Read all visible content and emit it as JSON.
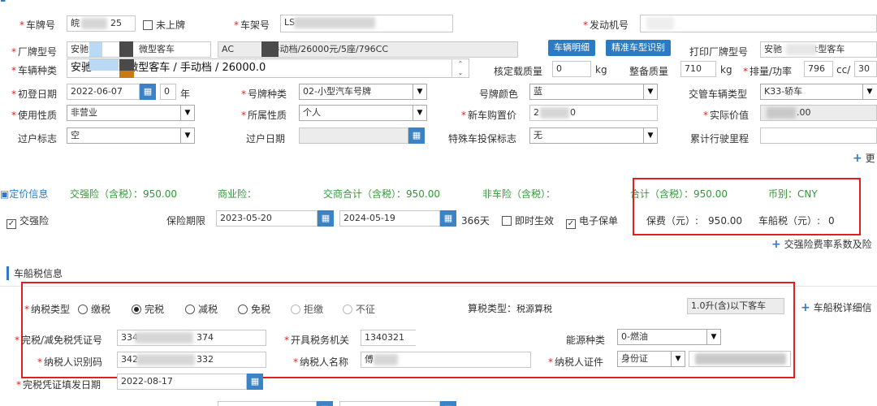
{
  "vehicle": {
    "plate_label": "车牌号",
    "plate_value": "皖",
    "plate_suffix": "25",
    "unplated_label": "未上牌",
    "vin_label": "车架号",
    "vin_value": "LS",
    "engine_label": "发动机号",
    "model_label": "厂牌型号",
    "model_value_a": "安驰",
    "model_value_b": "微型客车",
    "model_value_c": "AC",
    "model_value_d": "V手动档/26000元/5座/796CC",
    "detail_button": "车辆明细",
    "precise_button": "精准车型识别",
    "print_model_label": "打印厂牌型号",
    "print_model_value_a": "安驰",
    "print_model_value_b": "t型客车",
    "type_label": "车辆种类",
    "type_value_a": "安驰",
    "type_value_b": "E微型客车 / 手动档 / 26000.0",
    "load_label": "核定载质量",
    "load_value": "0",
    "load_unit": "kg",
    "curb_label": "整备质量",
    "curb_value": "710",
    "curb_unit": "kg",
    "power_label": "排量/功率",
    "power_value": "796",
    "power_unit": "cc/",
    "power_value2": "30",
    "reg_date_label": "初登日期",
    "reg_date_value": "2022-06-07",
    "years_value": "0",
    "years_unit": "年",
    "plate_type_label": "号牌种类",
    "plate_type_value": "02-小型汽车号牌",
    "plate_color_label": "号牌颜色",
    "plate_color_value": "蓝",
    "traffic_type_label": "交管车辆类型",
    "traffic_type_value": "K33-轿车",
    "usage_label": "使用性质",
    "usage_value": "非营业",
    "owner_type_label": "所属性质",
    "owner_type_value": "个人",
    "new_price_label": "新车购置价",
    "new_price_value": "2",
    "new_price_tail": "0",
    "actual_value_label": "实际价值",
    "actual_value_value": ".00",
    "transfer_label": "过户标志",
    "transfer_value": "空",
    "transfer_date_label": "过户日期",
    "special_label": "特殊车投保标志",
    "special_value": "无",
    "mileage_label": "累计行驶里程",
    "more_label": "更"
  },
  "pricing": {
    "section_label": "定价信息",
    "ctp_label": "交强险（含税）：",
    "ctp_value": "950.00",
    "commercial_label": "商业险：",
    "combined_label": "交商合计（含税）：",
    "combined_value": "950.00",
    "noncar_label": "非车险（含税）：",
    "total_label": "合计（含税）：",
    "total_value": "950.00",
    "currency_label": "币别：",
    "currency_value": "CNY"
  },
  "ctp": {
    "label": "交强险",
    "period_label": "保险期限",
    "start_date": "2023-05-20",
    "end_date": "2024-05-19",
    "days": "366天",
    "immediate_label": "即时生效",
    "epolicy_label": "电子保单",
    "premium_label": "保费（元）:",
    "premium_value": "950.00",
    "tax_label": "车船税（元）:",
    "tax_value": "0",
    "coef_link": "交强险费率系数及险"
  },
  "tax": {
    "section_label": "车船税信息",
    "kind_label": "纳税类型",
    "options": [
      "缴税",
      "完税",
      "减税",
      "免税",
      "拒缴",
      "不征"
    ],
    "calc_type_label": "算税类型：",
    "calc_type_value": "税源算税",
    "displacement_value": "1.0升(含)以下客车",
    "detail_link": "车船税详细信",
    "cert_no_label": "完税/减免税凭证号",
    "cert_no_a": "334",
    "cert_no_b": "374",
    "authority_label": "开具税务机关",
    "authority_value": "1340321",
    "energy_label": "能源种类",
    "energy_value": "0-燃油",
    "taxpayer_id_label": "纳税人识别码",
    "taxpayer_id_a": "342",
    "taxpayer_id_b": "332",
    "taxpayer_name_label": "纳税人名称",
    "taxpayer_name_value": "傅",
    "taxpayer_cert_label": "纳税人证件",
    "taxpayer_cert_value": "身份证",
    "cert_date_label": "完税凭证填发日期",
    "cert_date_value": "2022-08-17"
  }
}
